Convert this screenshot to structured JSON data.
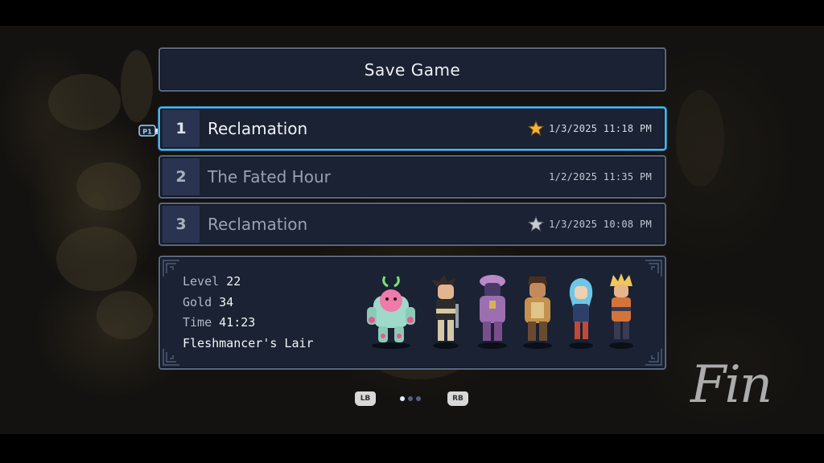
{
  "header": {
    "title": "Save Game"
  },
  "slots": [
    {
      "number": "1",
      "name": "Reclamation",
      "date": "1/3/2025 11:18 PM",
      "star": "gold-star-icon"
    },
    {
      "number": "2",
      "name": "The Fated Hour",
      "date": "1/2/2025 11:35 PM",
      "star": ""
    },
    {
      "number": "3",
      "name": "Reclamation",
      "date": "1/3/2025 10:08 PM",
      "star": "silver-star-icon"
    }
  ],
  "cursor": {
    "player_label": "P1"
  },
  "details": {
    "level_label": "Level",
    "level": "22",
    "gold_label": "Gold",
    "gold": "34",
    "time_label": "Time",
    "time": "41:23",
    "location": "Fleshmancer's Lair"
  },
  "pager": {
    "left_button": "LB",
    "right_button": "RB",
    "page_count": 3,
    "current_page": 1
  },
  "watermark": {
    "text": "Fin"
  },
  "colors": {
    "panel": "#1a2233",
    "panel_border": "#5a6780",
    "selected_border": "#4fb4ea",
    "gold_star": "#f2b53a",
    "silver_star": "#c8ccd6"
  }
}
